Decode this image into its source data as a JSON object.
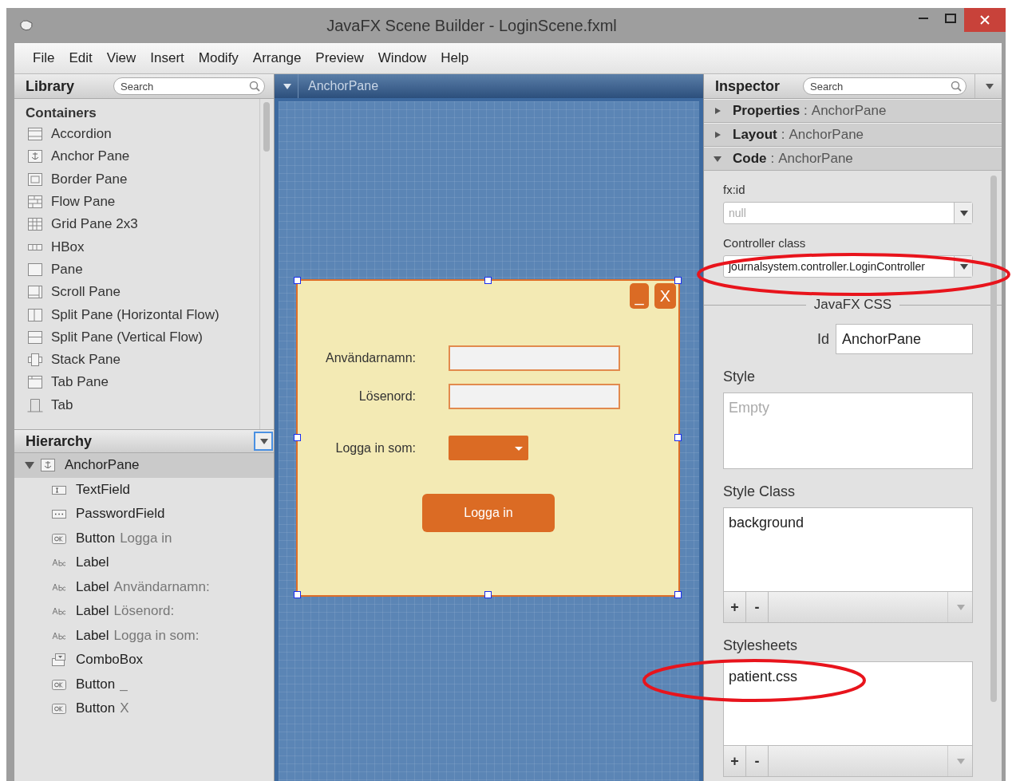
{
  "window": {
    "title": "JavaFX Scene Builder - LoginScene.fxml"
  },
  "menu": [
    "File",
    "Edit",
    "View",
    "Insert",
    "Modify",
    "Arrange",
    "Preview",
    "Window",
    "Help"
  ],
  "library": {
    "title": "Library",
    "search_placeholder": "Search",
    "section": "Containers",
    "items": [
      {
        "label": "Accordion",
        "kind": "accordion"
      },
      {
        "label": "Anchor Pane",
        "kind": "anchor"
      },
      {
        "label": "Border Pane",
        "kind": "border"
      },
      {
        "label": "Flow Pane",
        "kind": "flow"
      },
      {
        "label": "Grid Pane 2x3",
        "kind": "grid"
      },
      {
        "label": "HBox",
        "kind": "hbox"
      },
      {
        "label": "Pane",
        "kind": "pane"
      },
      {
        "label": "Scroll Pane",
        "kind": "scroll"
      },
      {
        "label": "Split Pane (Horizontal Flow)",
        "kind": "splith"
      },
      {
        "label": "Split Pane (Vertical Flow)",
        "kind": "splitv"
      },
      {
        "label": "Stack Pane",
        "kind": "stack"
      },
      {
        "label": "Tab Pane",
        "kind": "tabpane"
      },
      {
        "label": "Tab",
        "kind": "tab"
      }
    ]
  },
  "canvas": {
    "breadcrumb": "AnchorPane",
    "form": {
      "window_buttons": [
        "_",
        "X"
      ],
      "rows": [
        {
          "label": "Användarnamn:",
          "kind": "text"
        },
        {
          "label": "Lösenord:",
          "kind": "password"
        },
        {
          "label": "Logga in som:",
          "kind": "combo"
        }
      ],
      "button": "Logga in",
      "selected": true
    }
  },
  "hierarchy": {
    "title": "Hierarchy",
    "root": {
      "type": "AnchorPane",
      "kind": "anchor",
      "expanded": true,
      "selected": true,
      "children": [
        {
          "type": "TextField",
          "kind": "textfield"
        },
        {
          "type": "PasswordField",
          "kind": "password"
        },
        {
          "type": "Button",
          "detail": "Logga in",
          "kind": "button"
        },
        {
          "type": "Label",
          "kind": "label"
        },
        {
          "type": "Label",
          "detail": "Användarnamn:",
          "kind": "label"
        },
        {
          "type": "Label",
          "detail": "Lösenord:",
          "kind": "label"
        },
        {
          "type": "Label",
          "detail": "Logga in som:",
          "kind": "label"
        },
        {
          "type": "ComboBox",
          "kind": "combo"
        },
        {
          "type": "Button",
          "detail": "_",
          "kind": "button"
        },
        {
          "type": "Button",
          "detail": "X",
          "kind": "button"
        }
      ]
    }
  },
  "inspector": {
    "title": "Inspector",
    "search_placeholder": "Search",
    "sections": [
      {
        "title": "Properties",
        "separator": ":",
        "target": "AnchorPane",
        "expanded": false
      },
      {
        "title": "Layout",
        "separator": ":",
        "target": "AnchorPane",
        "expanded": false
      },
      {
        "title": "Code",
        "separator": ":",
        "target": "AnchorPane",
        "expanded": true
      }
    ],
    "code": {
      "fxid_label": "fx:id",
      "fxid_placeholder": "null",
      "controller_label": "Controller class",
      "controller_value": "journalsystem.controller.LoginController",
      "controller_circled": true
    },
    "css": {
      "heading": "JavaFX CSS",
      "id_label": "Id",
      "id_value": "AnchorPane",
      "style_label": "Style",
      "style_placeholder": "Empty",
      "style_class": {
        "label": "Style Class",
        "items": [
          {
            "name": "background",
            "circled": false
          }
        ],
        "buttons": [
          "+",
          "-"
        ]
      },
      "stylesheets": {
        "label": "Stylesheets",
        "items": [
          {
            "name": "patient.css",
            "circled": true
          }
        ],
        "buttons": [
          "+",
          "-"
        ]
      }
    }
  }
}
